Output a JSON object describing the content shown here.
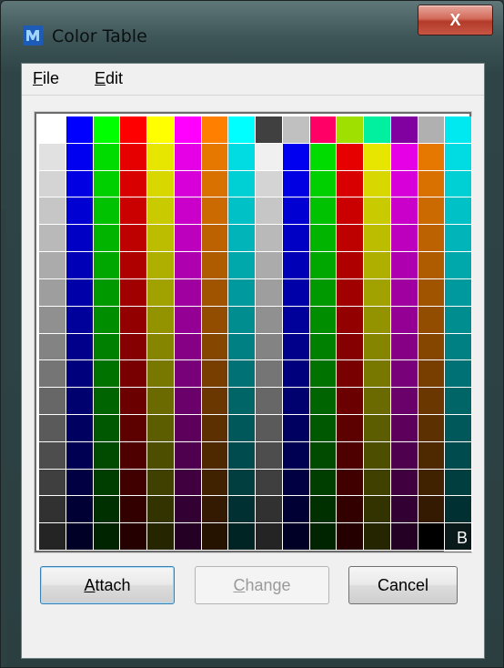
{
  "window": {
    "title": "Color Table",
    "close_label": "X",
    "app_icon": "microstation-icon"
  },
  "menu": {
    "items": [
      {
        "label": "File",
        "mnemonic": "F",
        "rest": "ile"
      },
      {
        "label": "Edit",
        "mnemonic": "E",
        "rest": "dit"
      }
    ]
  },
  "color_table": {
    "columns": 16,
    "rows": 16,
    "selected_label": "B",
    "column_base_colors": [
      "#ffffff",
      "#0000ff",
      "#00ff00",
      "#ff0000",
      "#ffff00",
      "#ff00ff",
      "#ff7f00",
      "#00ffff",
      "#404040",
      "#c0c0c0",
      "#ff0080",
      "#80ff00",
      "#00ff80",
      "#8000c0",
      "#b4b4b4",
      "#00ffff"
    ],
    "top_row": [
      "#ffffff",
      "#0000ff",
      "#00ff00",
      "#ff0000",
      "#ffff00",
      "#ff00ff",
      "#ff7f00",
      "#00ffff",
      "#404040",
      "#c0c0c0",
      "#ff0066",
      "#a0e000",
      "#00f0a0",
      "#8000a0",
      "#b0b0b0",
      "#00e8f0"
    ],
    "lower_columns": [
      "gray",
      "blue",
      "green",
      "red",
      "yellow",
      "magenta",
      "orange",
      "cyan",
      "gray",
      "blue",
      "green",
      "red",
      "yellow",
      "magenta",
      "orange",
      "cyan"
    ]
  },
  "buttons": {
    "attach": {
      "label": "Attach",
      "mnemonic": "A",
      "rest": "ttach"
    },
    "change": {
      "label": "Change",
      "mnemonic": "C",
      "rest": "hange"
    },
    "cancel": {
      "label": "Cancel"
    }
  }
}
